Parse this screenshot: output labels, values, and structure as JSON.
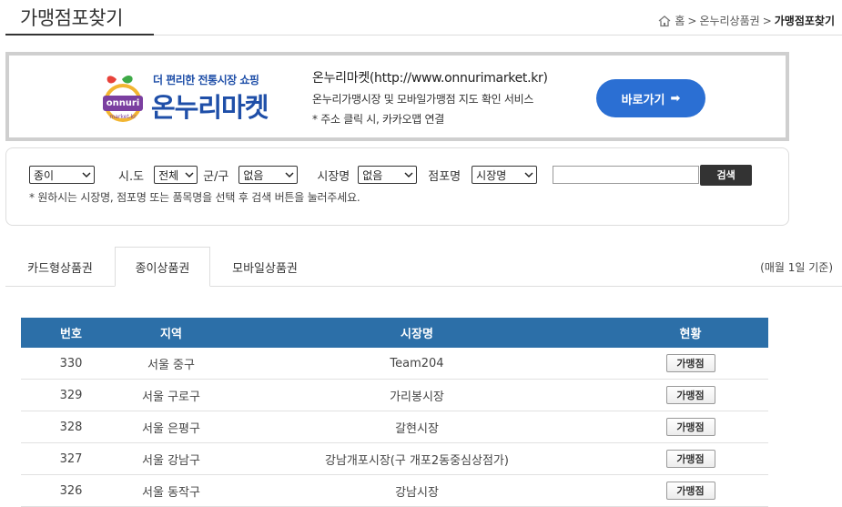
{
  "header": {
    "title": "가맹점포찾기",
    "breadcrumb": [
      "홈",
      "온누리상품권",
      "가맹점포찾기"
    ],
    "breadcrumb_separator": ">"
  },
  "banner": {
    "tagline": "더 편리한 전통시장 쇼핑",
    "logo_text": "온누리마켓",
    "logo_badge": "onnuri",
    "logo_badge_sub": "market.kr",
    "line1": "온누리마켓(http://www.onnurimarket.kr)",
    "line2": "온누리가맹시장 및 모바일가맹점 지도 확인 서비스",
    "line3": "* 주소 클릭 시, 카카오맵 연결",
    "button_label": "바로가기",
    "button_arrow": "➡",
    "button_color": "#2b6fd3"
  },
  "search": {
    "type_select": "종이",
    "sido_label": "시.도",
    "sido_select": "전체",
    "gungu_label": "군/구",
    "gungu_select": "없음",
    "market_label": "시장명",
    "market_select": "없음",
    "store_label": "점포명",
    "store_select": "시장명",
    "input_value": "",
    "button_label": "검색",
    "hint": "* 원하시는 시장명, 점포명 또는 품목명을 선택 후 검색 버튼을 눌러주세요."
  },
  "tabs": [
    {
      "label": "카드형상품권",
      "active": false
    },
    {
      "label": "종이상품권",
      "active": true
    },
    {
      "label": "모바일상품권",
      "active": false
    }
  ],
  "basis_note": "(매월 1일 기준)",
  "table": {
    "header_color": "#2c6fa8",
    "columns": [
      "번호",
      "지역",
      "시장명",
      "현황"
    ],
    "rows": [
      {
        "no": "330",
        "region": "서울 중구",
        "market": "Team204",
        "status": "가맹점"
      },
      {
        "no": "329",
        "region": "서울 구로구",
        "market": "가리봉시장",
        "status": "가맹점"
      },
      {
        "no": "328",
        "region": "서울 은평구",
        "market": "갈현시장",
        "status": "가맹점"
      },
      {
        "no": "327",
        "region": "서울 강남구",
        "market": "강남개포시장(구 개포2동중심상점가)",
        "status": "가맹점"
      },
      {
        "no": "326",
        "region": "서울 동작구",
        "market": "강남시장",
        "status": "가맹점"
      }
    ]
  }
}
